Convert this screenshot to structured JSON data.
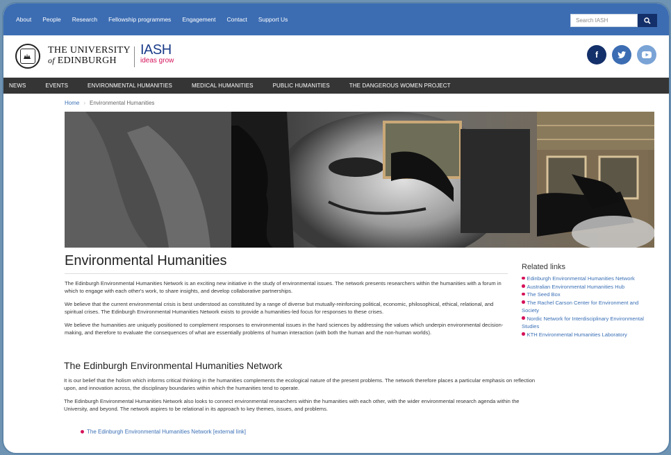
{
  "top_nav": {
    "items": [
      "About",
      "People",
      "Research",
      "Fellowship programmes",
      "Engagement",
      "Contact",
      "Support Us"
    ]
  },
  "search": {
    "placeholder": "Search IASH"
  },
  "brand": {
    "university_line1": "THE UNIVERSITY",
    "university_of": "of",
    "university_line2": "EDINBURGH",
    "iash_name": "IASH",
    "iash_tagline": "ideas grow"
  },
  "social": [
    {
      "icon": "facebook-icon",
      "glyph": "f",
      "color": "#14306a"
    },
    {
      "icon": "twitter-icon",
      "glyph": "t",
      "color": "#3c6db3"
    },
    {
      "icon": "youtube-icon",
      "glyph": "▶",
      "color": "#7aa3d6"
    }
  ],
  "main_nav": {
    "items": [
      "NEWS",
      "EVENTS",
      "ENVIRONMENTAL HUMANITIES",
      "MEDICAL HUMANITIES",
      "PUBLIC HUMANITIES",
      "THE DANGEROUS WOMEN PROJECT"
    ]
  },
  "breadcrumb": {
    "home": "Home",
    "current": "Environmental Humanities"
  },
  "page": {
    "title": "Environmental Humanities",
    "paragraphs": [
      "The Edinburgh Environmental Humanities Network is an exciting new initiative in the study of environmental issues. The network presents researchers within the humanities with a forum in which to engage with each other's work, to share insights, and develop collaborative partnerships.",
      "We believe that the current environmental crisis is best understood as constituted by a range of diverse but mutually-reinforcing political, economic, philosophical, ethical, relational, and spiritual crises. The Edinburgh Environmental Humanities Network exists to provide a humanities-led focus for responses to these crises.",
      "We believe the humanities are uniquely positioned to complement responses to environmental issues in the hard sciences by addressing the values which underpin environmental decision-making, and therefore to evaluate the consequences of what are essentially problems of human interaction (with both the human and the non-human worlds)."
    ],
    "section_title": "The Edinburgh Environmental Humanities Network",
    "section_paragraphs": [
      "It is our belief that the holism which informs critical thinking in the humanities complements the ecological nature of the present problems. The network therefore places a particular emphasis on reflection upon, and innovation across, the disciplinary boundaries within which the humanities tend to operate.",
      "The Edinburgh Environmental Humanities Network also looks to connect environmental researchers within the humanities with each other, with the wider environmental research agenda within the University, and beyond. The network aspires to be relational in its approach to key themes, issues, and problems."
    ],
    "external_link": "The Edinburgh Environmental Humanities Network [external link]"
  },
  "related": {
    "title": "Related links",
    "links": [
      "Edinburgh Environmental Humanities Network",
      "Australian Environmental Humanities Hub",
      "The Seed Box",
      "The Rachel Carson Center for Environment and Society",
      "Nordic Network for Interdisciplinary Environmental Studies",
      "KTH Environmental Humanities Laboratory"
    ]
  },
  "colors": {
    "top_bar": "#3c6db3",
    "main_nav": "#353535",
    "link": "#3a6fb5",
    "bullet": "#d6135a"
  }
}
